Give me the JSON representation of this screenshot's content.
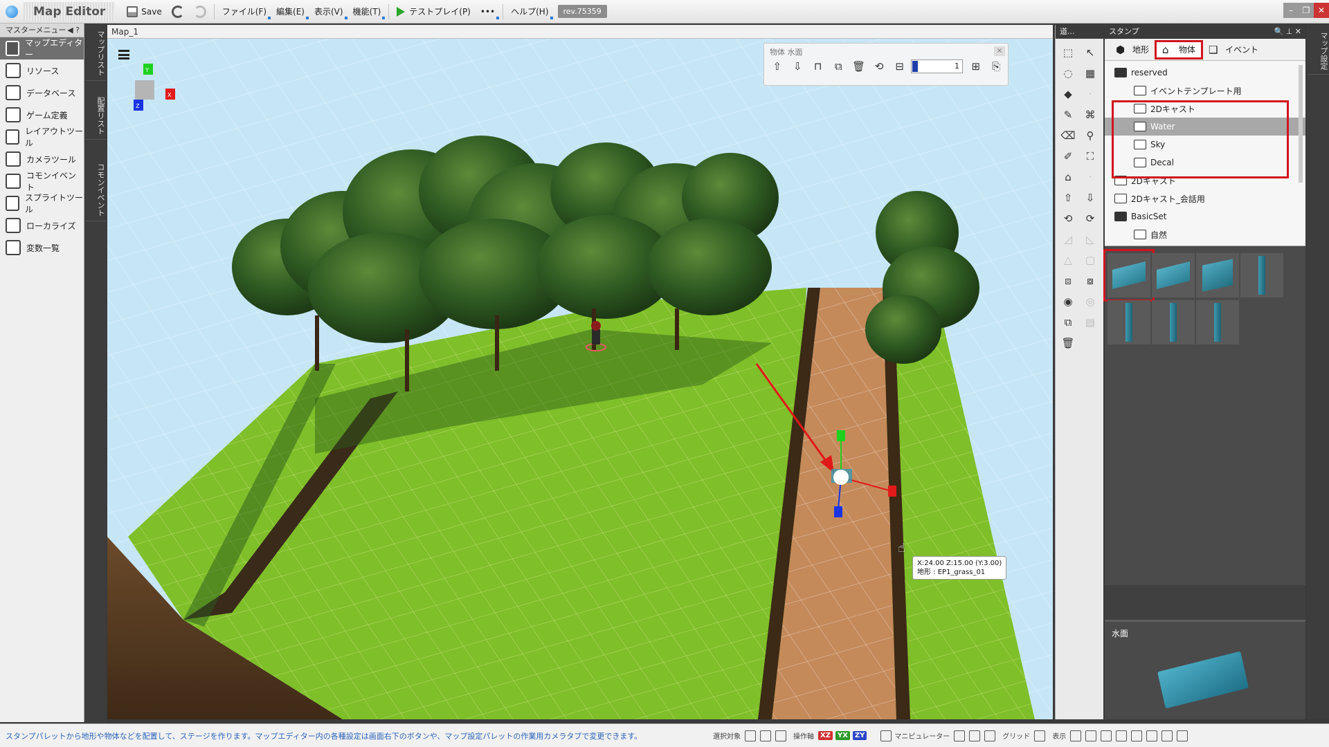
{
  "app": {
    "title": "Map Editor",
    "rev": "rev.75359"
  },
  "toolbar": {
    "save_label": "Save",
    "menus": [
      "ファイル(F)",
      "編集(E)",
      "表示(V)",
      "機能(T)"
    ],
    "testplay_label": "テストプレイ(P)",
    "more_label": "•••",
    "help_label": "ヘルプ(H)"
  },
  "leftmenu": {
    "header": "マスターメニュー",
    "items": [
      {
        "label": "マップエディター",
        "icon": "map-editor-icon",
        "active": true
      },
      {
        "label": "リソース",
        "icon": "resource-icon",
        "active": false
      },
      {
        "label": "データベース",
        "icon": "database-icon",
        "active": false
      },
      {
        "label": "ゲーム定義",
        "icon": "game-definition-icon",
        "active": false
      },
      {
        "label": "レイアウトツール",
        "icon": "layout-tool-icon",
        "active": false
      },
      {
        "label": "カメラツール",
        "icon": "camera-tool-icon",
        "active": false
      },
      {
        "label": "コモンイベント",
        "icon": "common-event-icon",
        "active": false
      },
      {
        "label": "スプライトツール",
        "icon": "sprite-tool-icon",
        "active": false
      },
      {
        "label": "ローカライズ",
        "icon": "localize-icon",
        "active": false
      },
      {
        "label": "変数一覧",
        "icon": "variables-icon",
        "active": false
      }
    ]
  },
  "vstrip": {
    "tabs": [
      "マップリスト",
      "配置リスト",
      "コモンイベント"
    ]
  },
  "viewport": {
    "tab_title": "Map_1",
    "objtool_title": "物体 水面",
    "objtool_value": "1",
    "tooltip_line1": "X:24.00 Z:15.00 (Y:3.00)",
    "tooltip_line2": "地形 : EP1_grass_01",
    "gizmo_labels": {
      "y": "Y",
      "x": "X",
      "z": "Z"
    }
  },
  "tools": {
    "header": "道..."
  },
  "stamp": {
    "header": "スタンプ",
    "tabs": [
      {
        "label": "地形",
        "icon": "terrain-icon",
        "active": false
      },
      {
        "label": "物体",
        "icon": "object-house-icon",
        "active": true
      },
      {
        "label": "イベント",
        "icon": "event-icon",
        "active": false
      }
    ],
    "tree": [
      {
        "label": "reserved",
        "depth": 0,
        "open": true,
        "selected": false
      },
      {
        "label": "イベントテンプレート用",
        "depth": 1,
        "open": false,
        "selected": false
      },
      {
        "label": "2Dキャスト",
        "depth": 1,
        "open": false,
        "selected": false
      },
      {
        "label": "Water",
        "depth": 1,
        "open": false,
        "selected": true
      },
      {
        "label": "Sky",
        "depth": 1,
        "open": false,
        "selected": false
      },
      {
        "label": "Decal",
        "depth": 1,
        "open": false,
        "selected": false
      },
      {
        "label": "2Dキャスト",
        "depth": 0,
        "open": false,
        "selected": false
      },
      {
        "label": "2Dキャスト_会話用",
        "depth": 0,
        "open": false,
        "selected": false
      },
      {
        "label": "BasicSet",
        "depth": 0,
        "open": true,
        "selected": false
      },
      {
        "label": "自然",
        "depth": 1,
        "open": false,
        "selected": false
      }
    ],
    "thumbnails": [
      {
        "shape": "slab",
        "selected": true
      },
      {
        "shape": "slab",
        "selected": false
      },
      {
        "shape": "box",
        "selected": false
      },
      {
        "shape": "pole",
        "selected": false
      },
      {
        "shape": "pole",
        "selected": false
      },
      {
        "shape": "pole",
        "selected": false
      },
      {
        "shape": "pole",
        "selected": false
      }
    ],
    "preview_label": "水面"
  },
  "rstrip": {
    "tabs": [
      "マップ設定"
    ]
  },
  "statusbar": {
    "message": "スタンプパレットから地形や物体などを配置して、ステージを作ります。マップエディター内の各種設定は画面右下のボタンや、マップ設定パレットの作業用カメラタブで変更できます。",
    "select_target_label": "選択対象",
    "operation_axis_label": "操作軸",
    "axes": [
      "XZ",
      "YX",
      "ZY"
    ],
    "manipulator_label": "マニピュレーター",
    "grid_label": "グリッド",
    "display_label": "表示"
  },
  "colors": {
    "accent_red": "#d0141e",
    "grass": "#7fbf2a",
    "path": "#c58a5a",
    "water": "#3a98b0"
  }
}
